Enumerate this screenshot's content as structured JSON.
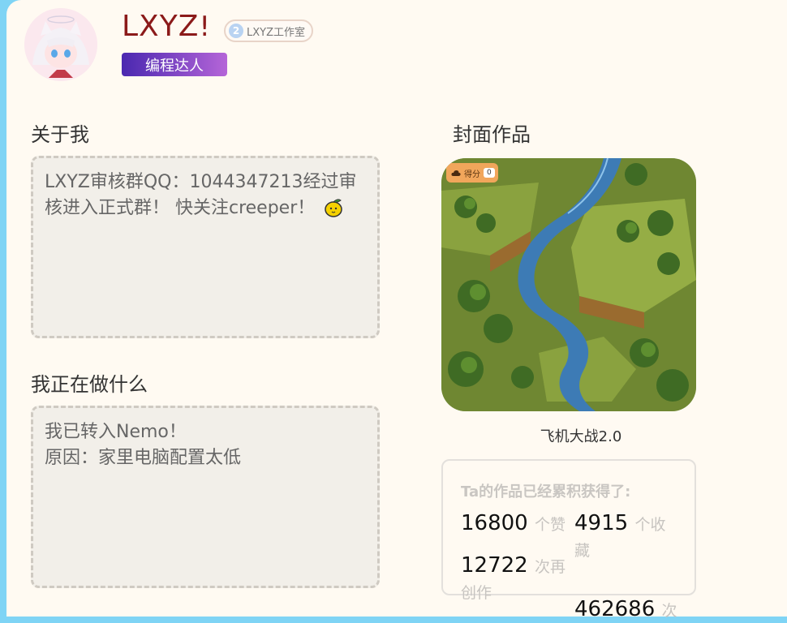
{
  "profile": {
    "username": "LXYZ",
    "username_mark": "!",
    "studio_level": "2",
    "studio_name": "LXYZ工作室",
    "tag": "编程达人"
  },
  "about": {
    "title": "关于我",
    "text": "LXYZ审核群QQ：1044347213经过审核进入正式群！ 快关注creeper！"
  },
  "doing": {
    "title": "我正在做什么",
    "lines": [
      "我已转入Nemo！",
      "原因：家里电脑配置太低"
    ]
  },
  "cover": {
    "title": "封面作品",
    "score_label": "得分",
    "score_value": "0",
    "work_title": "飞机大战2.0"
  },
  "stats": {
    "header": "Ta的作品已经累积获得了:",
    "likes": {
      "value": "16800",
      "unit": "个赞"
    },
    "favorites": {
      "value": "4915",
      "unit": "个收藏"
    },
    "remixes": {
      "value": "12722",
      "unit": "次再创作"
    },
    "views": {
      "value": "462686",
      "unit": "次"
    }
  },
  "colors": {
    "page_accent": "#7fd4f5",
    "username": "#8b1a1a",
    "tag_gradient": [
      "#4a28b0",
      "#b565d8"
    ]
  }
}
